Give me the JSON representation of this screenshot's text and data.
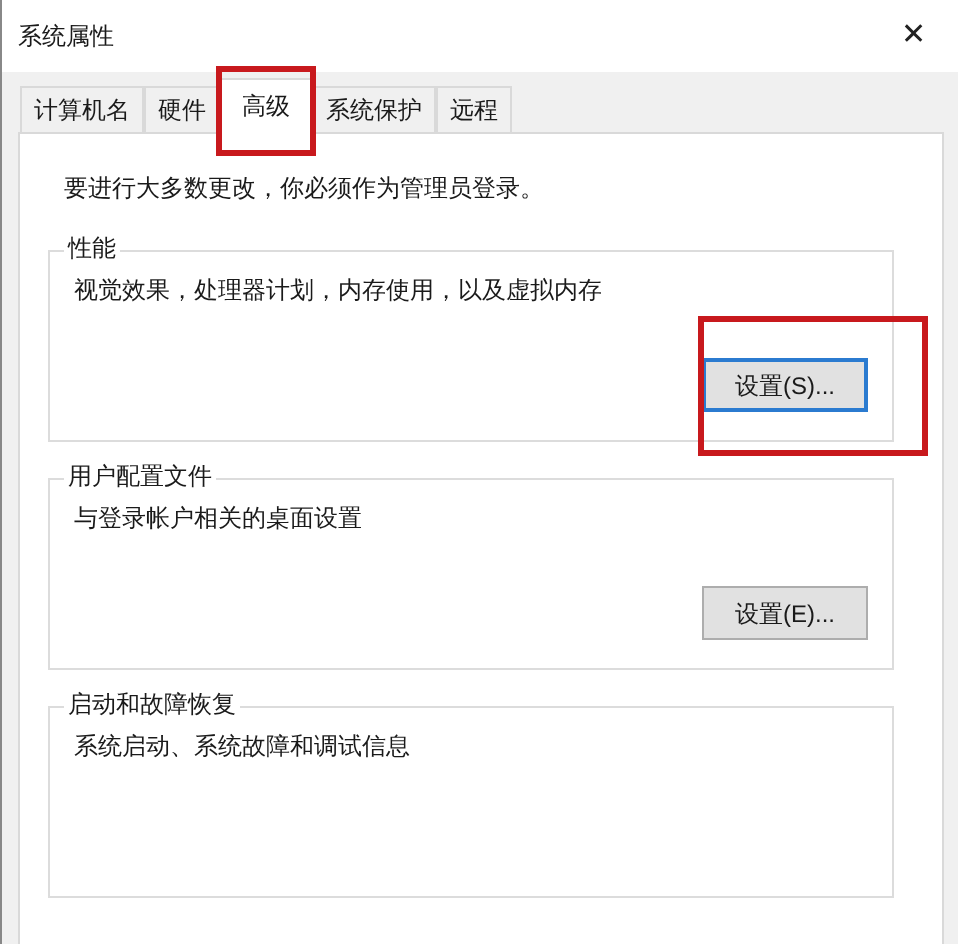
{
  "window": {
    "title": "系统属性",
    "close": "✕"
  },
  "tabs": [
    {
      "label": "计算机名",
      "selected": false
    },
    {
      "label": "硬件",
      "selected": false
    },
    {
      "label": "高级",
      "selected": true,
      "highlighted": true
    },
    {
      "label": "系统保护",
      "selected": false
    },
    {
      "label": "远程",
      "selected": false
    }
  ],
  "notice": "要进行大多数更改，你必须作为管理员登录。",
  "groups": [
    {
      "title": "性能",
      "description": "视觉效果，处理器计划，内存使用，以及虚拟内存",
      "button": {
        "label": "设置(S)...",
        "default": true,
        "highlighted": true
      }
    },
    {
      "title": "用户配置文件",
      "description": "与登录帐户相关的桌面设置",
      "button": {
        "label": "设置(E)...",
        "default": false
      }
    },
    {
      "title": "启动和故障恢复",
      "description": "系统启动、系统故障和调试信息"
    }
  ]
}
